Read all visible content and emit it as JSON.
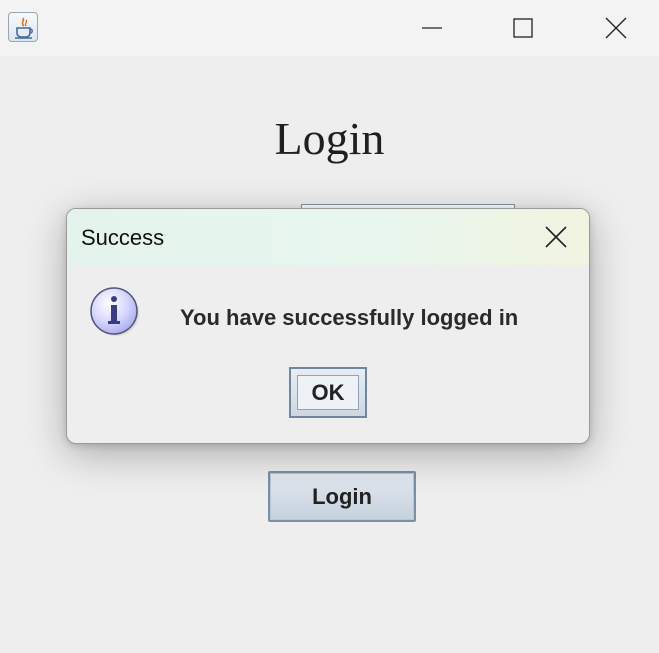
{
  "window": {
    "app_icon": "java-icon",
    "controls": [
      "minimize-icon",
      "maximize-icon",
      "close-icon"
    ]
  },
  "form": {
    "title": "Login",
    "login_button_label": "Login"
  },
  "dialog": {
    "title": "Success",
    "icon": "info-icon",
    "message": "You have successfully logged in",
    "ok_label": "OK"
  }
}
